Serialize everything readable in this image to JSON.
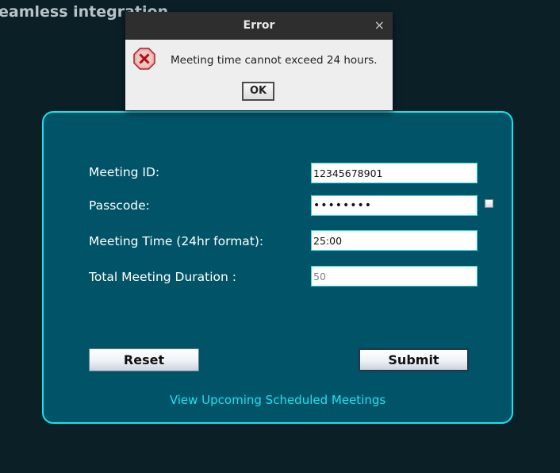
{
  "background_title": "eamless integration",
  "form": {
    "meeting_id_label": "Meeting ID:",
    "meeting_id_value": "12345678901",
    "passcode_label": "Passcode:",
    "passcode_value": "••••••••",
    "meeting_time_label": "Meeting Time (24hr format):",
    "meeting_time_value": "25:00",
    "duration_label": "Total Meeting Duration :",
    "duration_value": "50",
    "reset_label": "Reset",
    "submit_label": "Submit",
    "link_label": "View Upcoming Scheduled Meetings"
  },
  "dialog": {
    "title": "Error",
    "close_glyph": "×",
    "message": "Meeting time cannot exceed 24 hours.",
    "ok_label": "OK",
    "icon": "error-icon"
  },
  "colors": {
    "background": "#0b1f27",
    "panel": "#015468",
    "panel_border": "#17e2ee",
    "link": "#22e0ee"
  }
}
